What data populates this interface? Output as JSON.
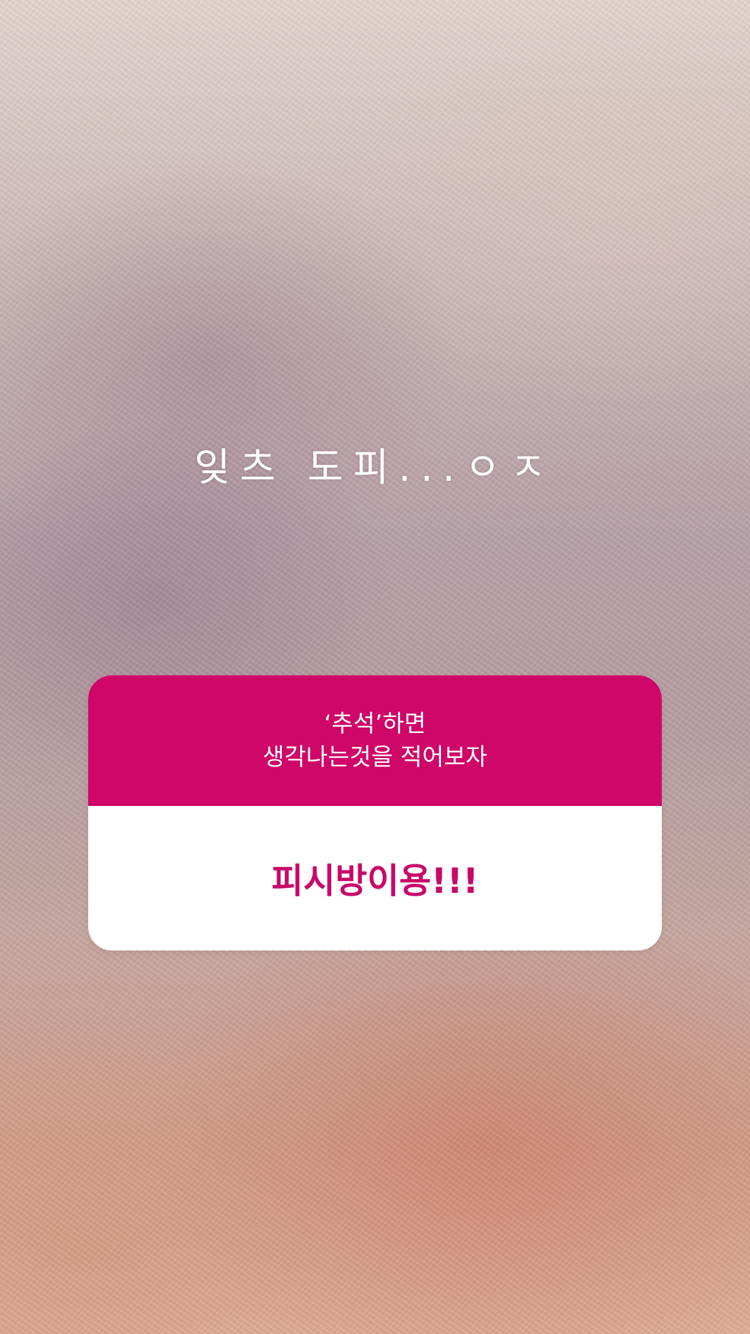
{
  "story": {
    "caption": "잊츠 도피...ㅇㅈ",
    "background": "fuzzy-blanket-photo"
  },
  "question_sticker": {
    "question_line1": "‘추석’하면",
    "question_line2": "생각나는것을 적어보자",
    "answer": "피시방이용!!!",
    "header_color": "#cf0768",
    "answer_color": "#c8096a"
  }
}
